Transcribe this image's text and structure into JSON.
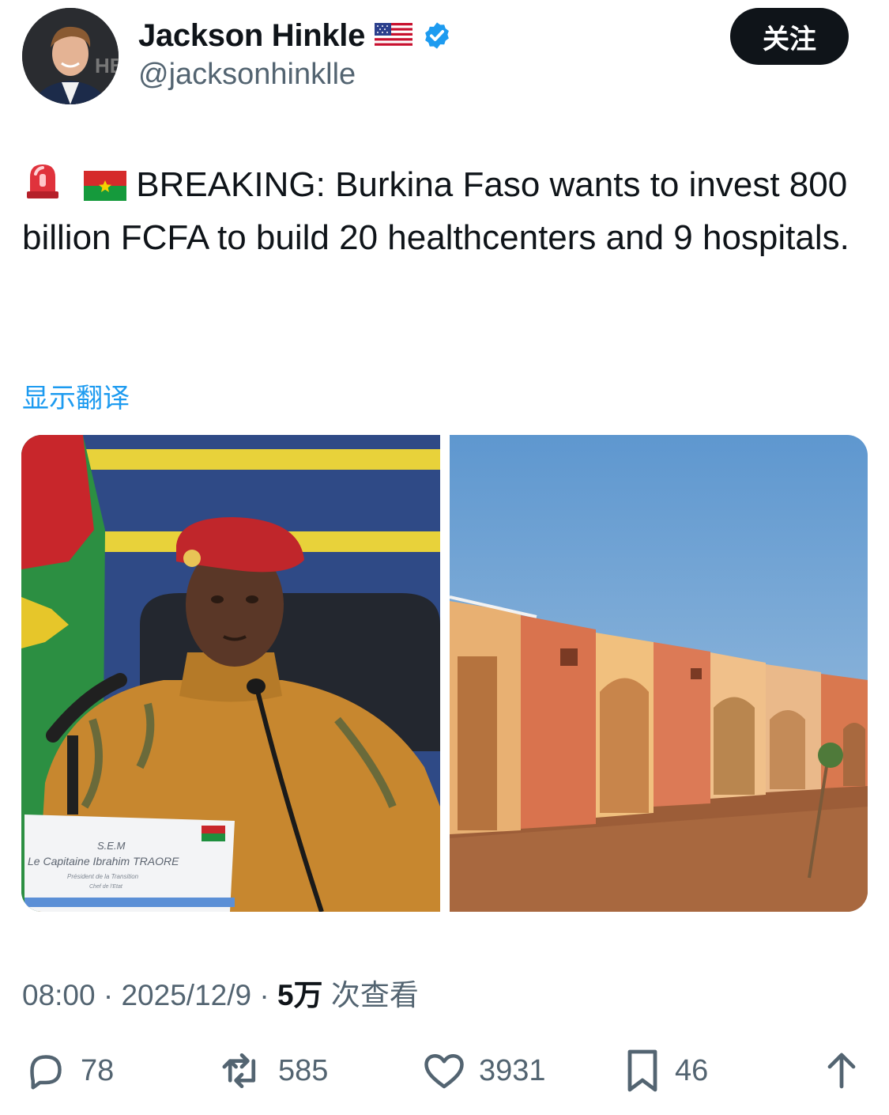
{
  "author": {
    "display_name": "Jackson Hinkle",
    "handle": "@jacksonhinklle",
    "flag_icon": "us-flag-icon",
    "verified_icon": "verified-badge-icon",
    "verified_color": "#1d9bf0"
  },
  "follow_button": {
    "label": "关注"
  },
  "tweet": {
    "emojis": [
      "rotating-light-icon",
      "burkina-faso-flag-icon"
    ],
    "text": "BREAKING: Burkina Faso wants to invest 800 billion FCFA to build 20 healthcenters and 9 hospitals."
  },
  "translate_link": {
    "label": "显示翻译"
  },
  "media": {
    "photo_1": {
      "nameplate_line1": "S.E.M",
      "nameplate_line2": "Le Capitaine Ibrahim TRAORE",
      "nameplate_line3": "Président de la Transition",
      "nameplate_line4": "Chef de l'Etat"
    },
    "photo_2": {}
  },
  "meta": {
    "time": "08:00",
    "date": "2025/12/9",
    "views_count": "5万",
    "views_label": "次查看",
    "separator": "·"
  },
  "actions": {
    "replies": "78",
    "reposts": "585",
    "likes": "3931",
    "bookmarks": "46"
  },
  "colors": {
    "accent": "#1d9bf0",
    "muted": "#536471",
    "text": "#0f1419"
  }
}
